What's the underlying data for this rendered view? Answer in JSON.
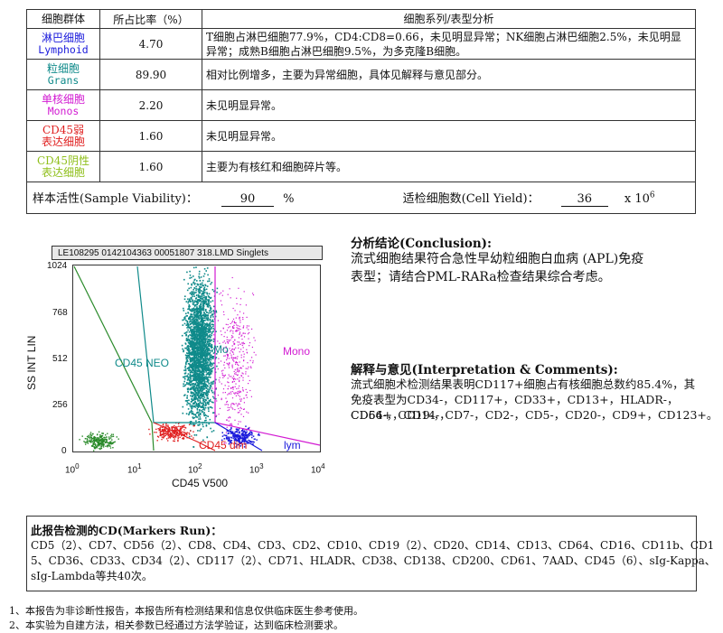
{
  "table": {
    "headers": [
      "细胞群体",
      "所占比率（%）",
      "细胞系列/表型分析"
    ],
    "rows": [
      {
        "name": "淋巴细胞",
        "sub": "Lymphoid",
        "color": "#1a1adb",
        "ratio": "4.70",
        "desc1": "T细胞占淋巴细胞77.9%，CD4:CD8=0.66，未见明显异常；NK细胞占淋巴细胞2.5%，未见明显",
        "desc2": "异常；成熟B细胞占淋巴细胞9.5%，为多克隆B细胞。"
      },
      {
        "name": "粒细胞",
        "sub": "Grans",
        "color": "#0f8a8a",
        "ratio": "89.90",
        "desc1": "相对比例增多，主要为异常细胞，具体见解释与意见部分。",
        "desc2": ""
      },
      {
        "name": "单核细胞",
        "sub": "Monos",
        "color": "#d21ad2",
        "ratio": "2.20",
        "desc1": "未见明显异常。",
        "desc2": ""
      },
      {
        "name": "CD45弱",
        "sub": "表达细胞",
        "color": "#e02020",
        "ratio": "1.60",
        "desc1": "未见明显异常。",
        "desc2": ""
      },
      {
        "name": "CD45阴性",
        "sub": "表达细胞",
        "color": "#8fbf1a",
        "ratio": "1.60",
        "desc1": "主要为有核红和细胞碎片等。",
        "desc2": ""
      }
    ],
    "viability_label": "样本活性(Sample Viability)：",
    "viability_value": "90",
    "viability_unit": "%",
    "yield_label": "适检细胞数(Cell Yield)：",
    "yield_value": "36",
    "yield_unit": "x 10",
    "yield_exp": "6"
  },
  "plot": {
    "title": "LE108295 0142104363 00051807 318.LMD   Singlets",
    "ylabel": "SS INT LIN",
    "xlabel": "CD45 V500",
    "y_ticks": [
      "1024",
      "768",
      "512",
      "256",
      "0"
    ],
    "x_ticks": [
      "10",
      "10",
      "10",
      "10",
      "10"
    ],
    "x_exps": [
      "0",
      "1",
      "2",
      "3",
      "4"
    ],
    "gates": {
      "neo": "CD45 NEO",
      "mo": "Mo",
      "mono": "Mono",
      "dim": "CD45 dim",
      "lym": "lym"
    },
    "colors": {
      "grans": "#0f8a8a",
      "mono": "#d21ad2",
      "dim": "#e02020",
      "lym": "#1a1adb",
      "neg": "#2a8a2a"
    }
  },
  "conclusion": {
    "title": "分析结论(Conclusion):",
    "line1": "流式细胞结果符合急性早幼粒细胞白血病 (APL)免疫",
    "line2": "表型；请结合PML-RARa检查结果综合考虑。"
  },
  "interpretation": {
    "title": "解释与意见(Interpretation & Comments):",
    "line1": "流式细胞术检测结果表明CD117+细胞占有核细胞总数约85.4%，其",
    "line2": "免疫表型为CD34-，CD117+，CD33+，CD13+，HLADR-，CD64+，CD14-，",
    "line3": "CD56-，CD19-，CD7-，CD2-，CD5-，CD20-，CD9+，CD123+。"
  },
  "markers": {
    "title": "此报告检测的CD(Markers Run)：",
    "line1": "CD5（2）、CD7、CD56（2）、CD8、CD4、CD3、CD2、CD10、CD19（2）、CD20、CD14、CD13、CD64、CD16、CD11b、CD1",
    "line2": "5、CD36、CD33、CD34（2）、CD117（2）、CD71、HLADR、CD38、CD138、CD200、CD61、7AAD、CD45（6）、sIg-Kappa、",
    "line3": "sIg-Lambda等共40次。"
  },
  "notes": {
    "n1": "1、本报告为非诊断性报告，本报告所有检测结果和信息仅供临床医生参考使用。",
    "n2": "2、本实验为自建方法，相关参数已经通过方法学验证，达到临床检测要求。"
  }
}
